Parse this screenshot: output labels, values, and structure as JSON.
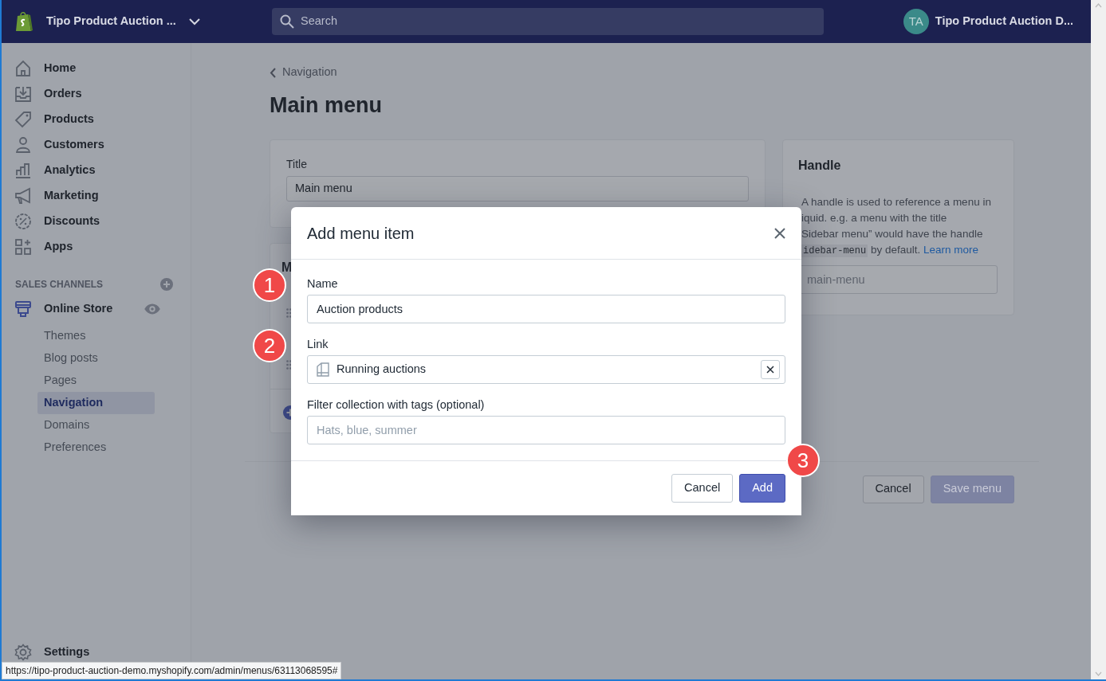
{
  "top_bar": {
    "store_name": "Tipo Product Auction ...",
    "search": {
      "placeholder": "Search"
    },
    "avatar_initials": "TA",
    "account_name": "Tipo Product Auction D..."
  },
  "sidebar": {
    "items": [
      {
        "label": "Home",
        "selected": false
      },
      {
        "label": "Orders",
        "selected": false
      },
      {
        "label": "Products",
        "selected": false
      },
      {
        "label": "Customers",
        "selected": false
      },
      {
        "label": "Analytics",
        "selected": false
      },
      {
        "label": "Marketing",
        "selected": false
      },
      {
        "label": "Discounts",
        "selected": false
      },
      {
        "label": "Apps",
        "selected": false
      }
    ],
    "section_heading": "SALES CHANNELS",
    "channel": {
      "label": "Online Store",
      "children": [
        {
          "label": "Themes",
          "selected": false
        },
        {
          "label": "Blog posts",
          "selected": false
        },
        {
          "label": "Pages",
          "selected": false
        },
        {
          "label": "Navigation",
          "selected": true
        },
        {
          "label": "Domains",
          "selected": false
        },
        {
          "label": "Preferences",
          "selected": false
        }
      ]
    },
    "settings": {
      "label": "Settings"
    }
  },
  "page": {
    "breadcrumb": "Navigation",
    "title": "Main menu",
    "title_card": {
      "label": "Title",
      "value": "Main menu"
    },
    "menu_items_card": {
      "heading": "M"
    },
    "handle_card": {
      "heading": "Handle",
      "lines": [
        "A handle is used to reference a menu in",
        "iquid. e.g. a menu with the title",
        "Sidebar menu” would have the handle"
      ],
      "code": "idebar-menu",
      "after_code": " by default. ",
      "link": "Learn more",
      "placeholder": "main-menu"
    },
    "footer_buttons": [
      {
        "label": "Cancel",
        "kind": "secondary",
        "disabled": false
      },
      {
        "label": "Save menu",
        "kind": "primary",
        "disabled": true
      }
    ]
  },
  "modal": {
    "title": "Add menu item",
    "fields": [
      {
        "kind": "text",
        "label": "Name",
        "value": "Auction products",
        "annotation": "1"
      },
      {
        "kind": "link",
        "label": "Link",
        "value": "Running auctions",
        "annotation": "2"
      },
      {
        "kind": "text",
        "label": "Filter collection with tags (optional)",
        "placeholder": "Hats, blue, summer"
      }
    ],
    "buttons": [
      {
        "label": "Cancel",
        "kind": "secondary"
      },
      {
        "label": "Add",
        "kind": "primary",
        "annotation": "3"
      }
    ]
  },
  "status_bar": {
    "url": "https://tipo-product-auction-demo.myshopify.com/admin/menus/63113068595#"
  }
}
